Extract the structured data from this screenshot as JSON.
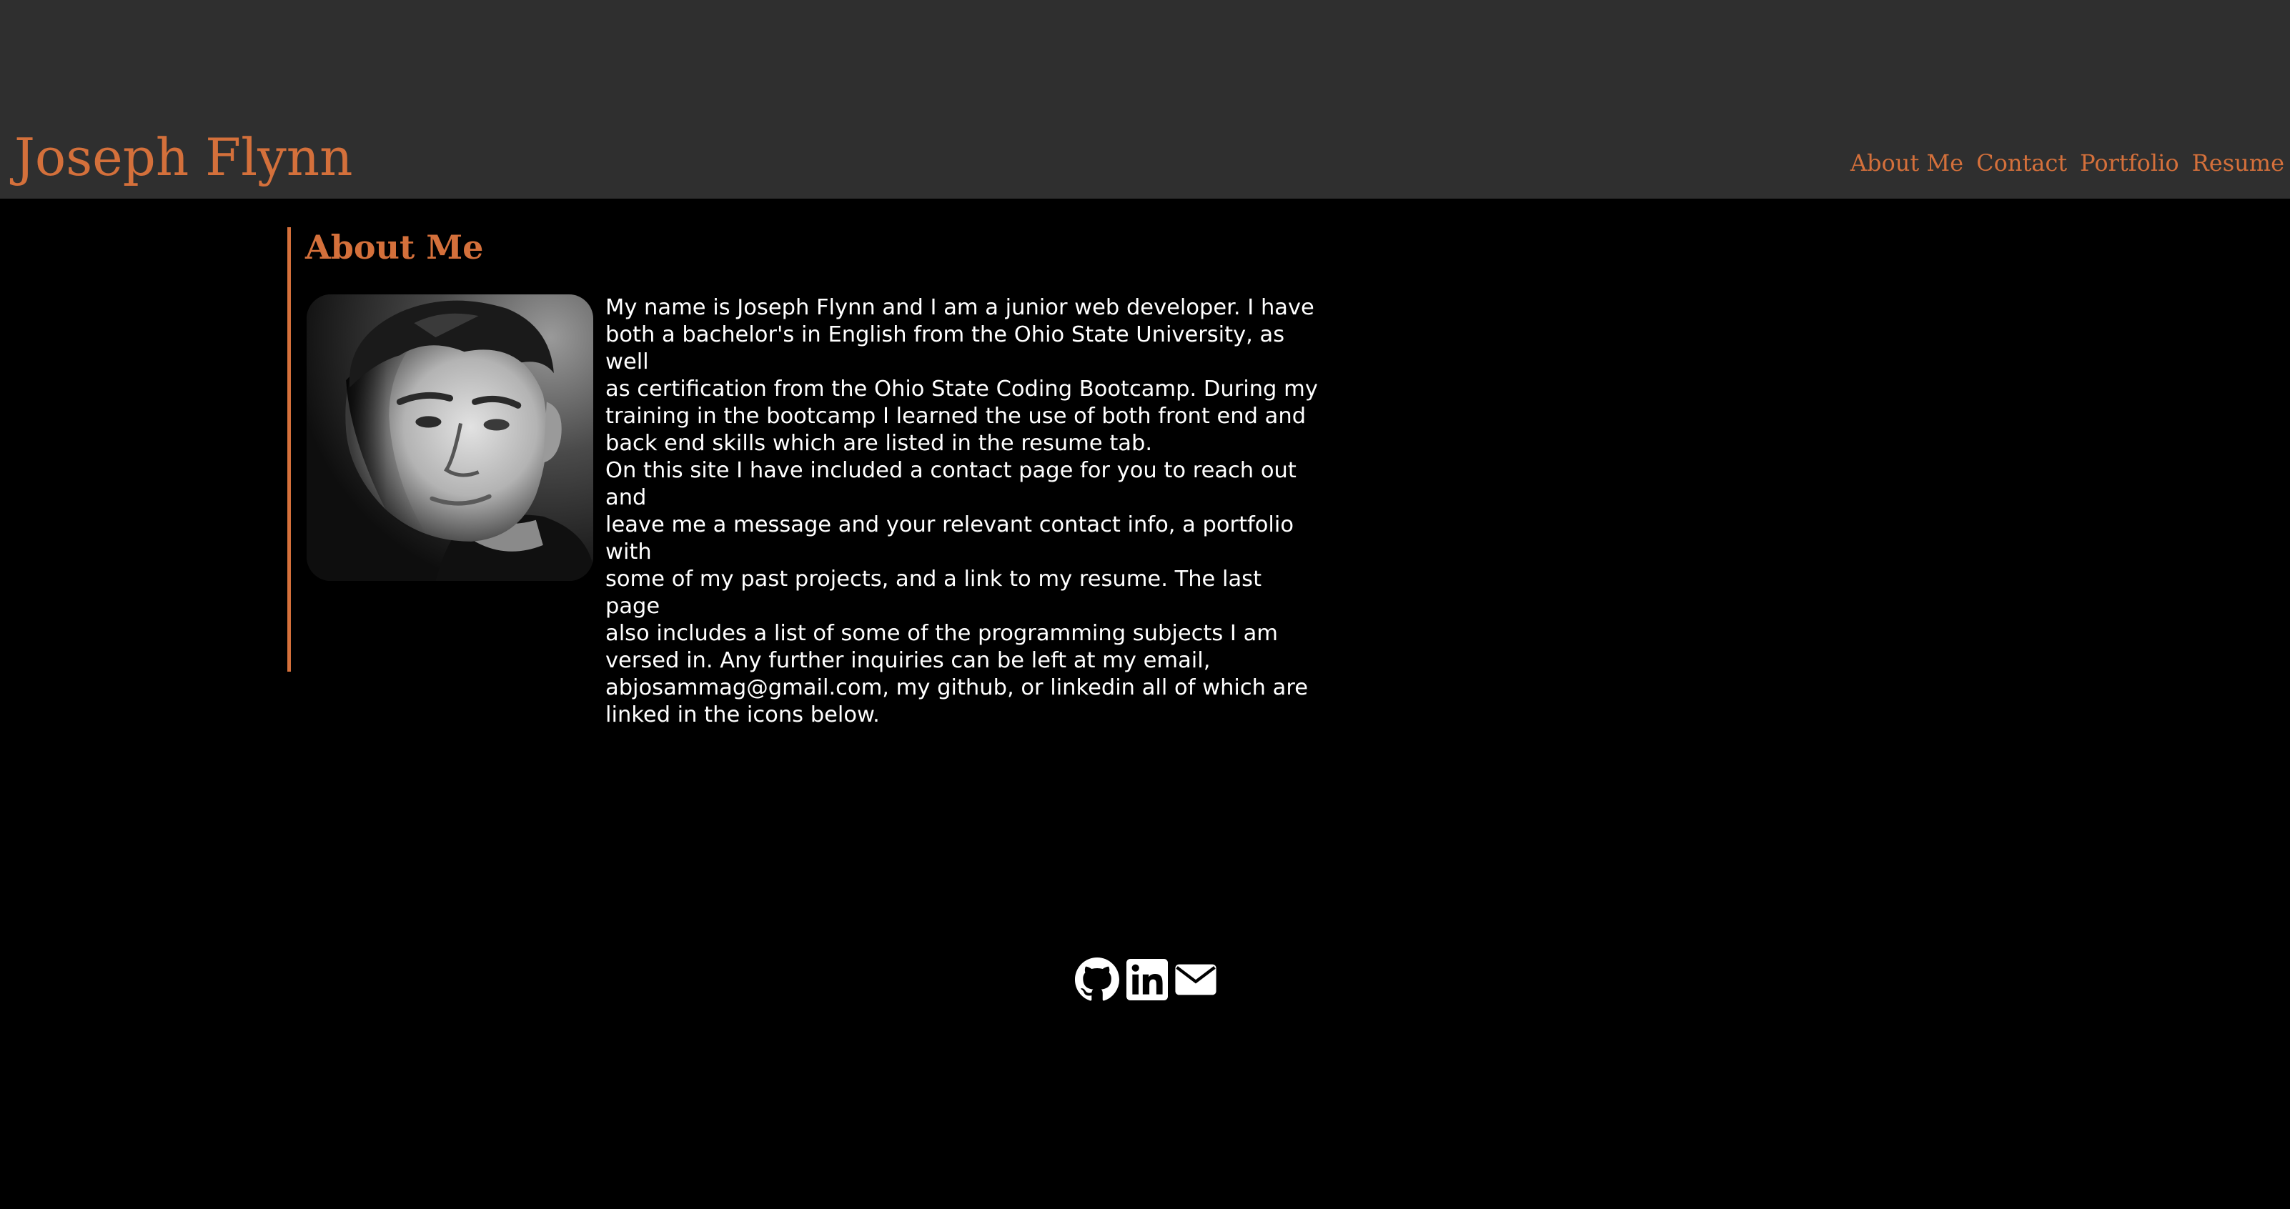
{
  "header": {
    "title": "Joseph Flynn",
    "nav": [
      {
        "label": "About Me"
      },
      {
        "label": "Contact"
      },
      {
        "label": "Portfolio"
      },
      {
        "label": "Resume"
      }
    ]
  },
  "about": {
    "heading": "About Me",
    "paragraphs": [
      "My name is Joseph Flynn and I am a junior web developer. I have\nboth a bachelor's in English from the Ohio State University, as well\nas certification from the Ohio State Coding Bootcamp. During my\ntraining in the bootcamp I learned the use of both front end and\nback end skills which are listed in the resume tab.",
      "On this site I have included a contact page for you to reach out and\nleave me a message and your relevant contact info, a portfolio with\nsome of my past projects, and a link to my resume. The last page\nalso includes a list of some of the programming subjects I am\nversed in. Any further inquiries can be left at my email,\nabjosammag@gmail.com, my github, or linkedin all of which are\nlinked in the icons below."
    ]
  },
  "footer": {
    "icons": [
      "github-icon",
      "linkedin-icon",
      "email-icon"
    ]
  },
  "colors": {
    "accent": "#d4703b",
    "header_bg": "#2f2f2f",
    "page_bg": "#000000",
    "text": "#ffffff"
  }
}
